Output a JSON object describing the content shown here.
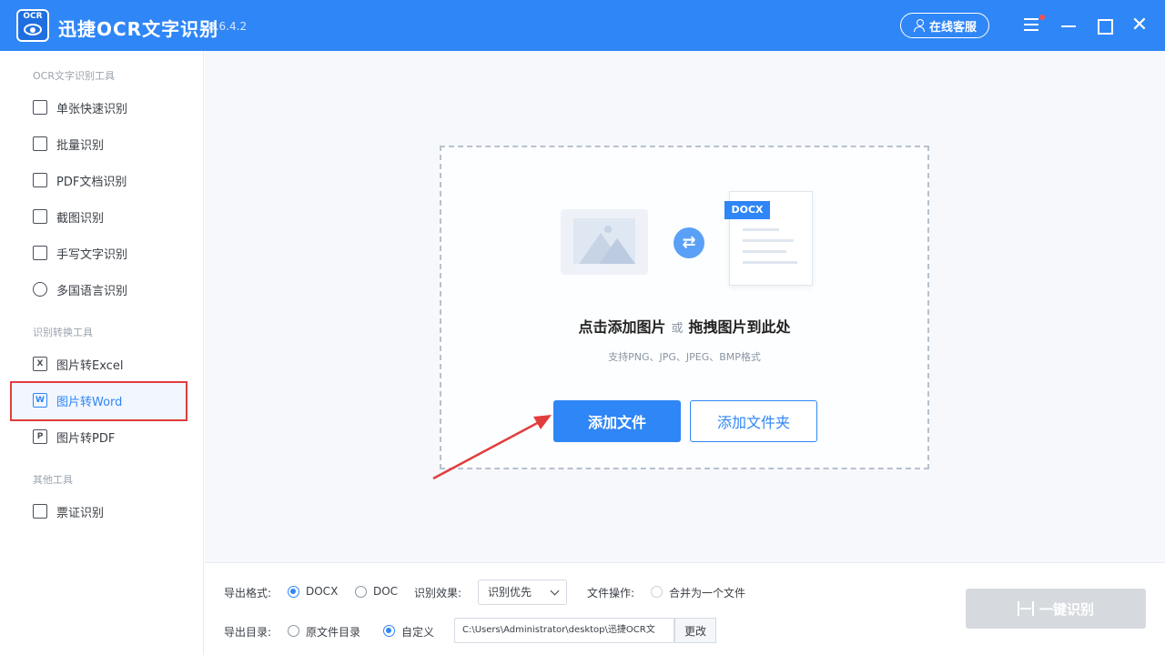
{
  "titlebar": {
    "logo_text": "OCR",
    "title": "迅捷OCR文字识别",
    "version": "v8.6.4.2",
    "service_label": "在线客服"
  },
  "sidebar": {
    "sections": [
      {
        "label": "OCR文字识别工具",
        "items": [
          {
            "label": "单张快速识别",
            "icon": "single-scan-icon"
          },
          {
            "label": "批量识别",
            "icon": "batch-icon"
          },
          {
            "label": "PDF文档识别",
            "icon": "pdf-doc-icon"
          },
          {
            "label": "截图识别",
            "icon": "crop-icon"
          },
          {
            "label": "手写文字识别",
            "icon": "handwriting-icon"
          },
          {
            "label": "多国语言识别",
            "icon": "globe-icon"
          }
        ]
      },
      {
        "label": "识别转换工具",
        "items": [
          {
            "label": "图片转Excel",
            "icon": "excel-icon",
            "glyph": "X"
          },
          {
            "label": "图片转Word",
            "icon": "word-icon",
            "glyph": "W",
            "active": true
          },
          {
            "label": "图片转PDF",
            "icon": "pdf-icon",
            "glyph": "P"
          }
        ]
      },
      {
        "label": "其他工具",
        "items": [
          {
            "label": "票证识别",
            "icon": "ticket-icon"
          }
        ]
      }
    ]
  },
  "dropzone": {
    "doc_tag": "DOCX",
    "swap_glyph": "⇄",
    "title_part1": "点击添加图片",
    "title_or": "或",
    "title_part2": "拖拽图片到此处",
    "subtitle": "支持PNG、JPG、JPEG、BMP格式",
    "add_file_label": "添加文件",
    "add_folder_label": "添加文件夹"
  },
  "bottom": {
    "export_format_label": "导出格式:",
    "format_docx": "DOCX",
    "format_doc": "DOC",
    "effect_label": "识别效果:",
    "effect_value": "识别优先",
    "file_op_label": "文件操作:",
    "merge_label": "合并为一个文件",
    "export_dir_label": "导出目录:",
    "dir_original": "原文件目录",
    "dir_custom": "自定义",
    "path_value": "C:\\Users\\Administrator\\desktop\\迅捷OCR文",
    "change_label": "更改",
    "start_label": "一键识别"
  },
  "colors": {
    "primary": "#2f86f6",
    "highlight_border": "#e23d3d",
    "arrow": "#e23d3d",
    "disabled_button": "#d6dade"
  }
}
